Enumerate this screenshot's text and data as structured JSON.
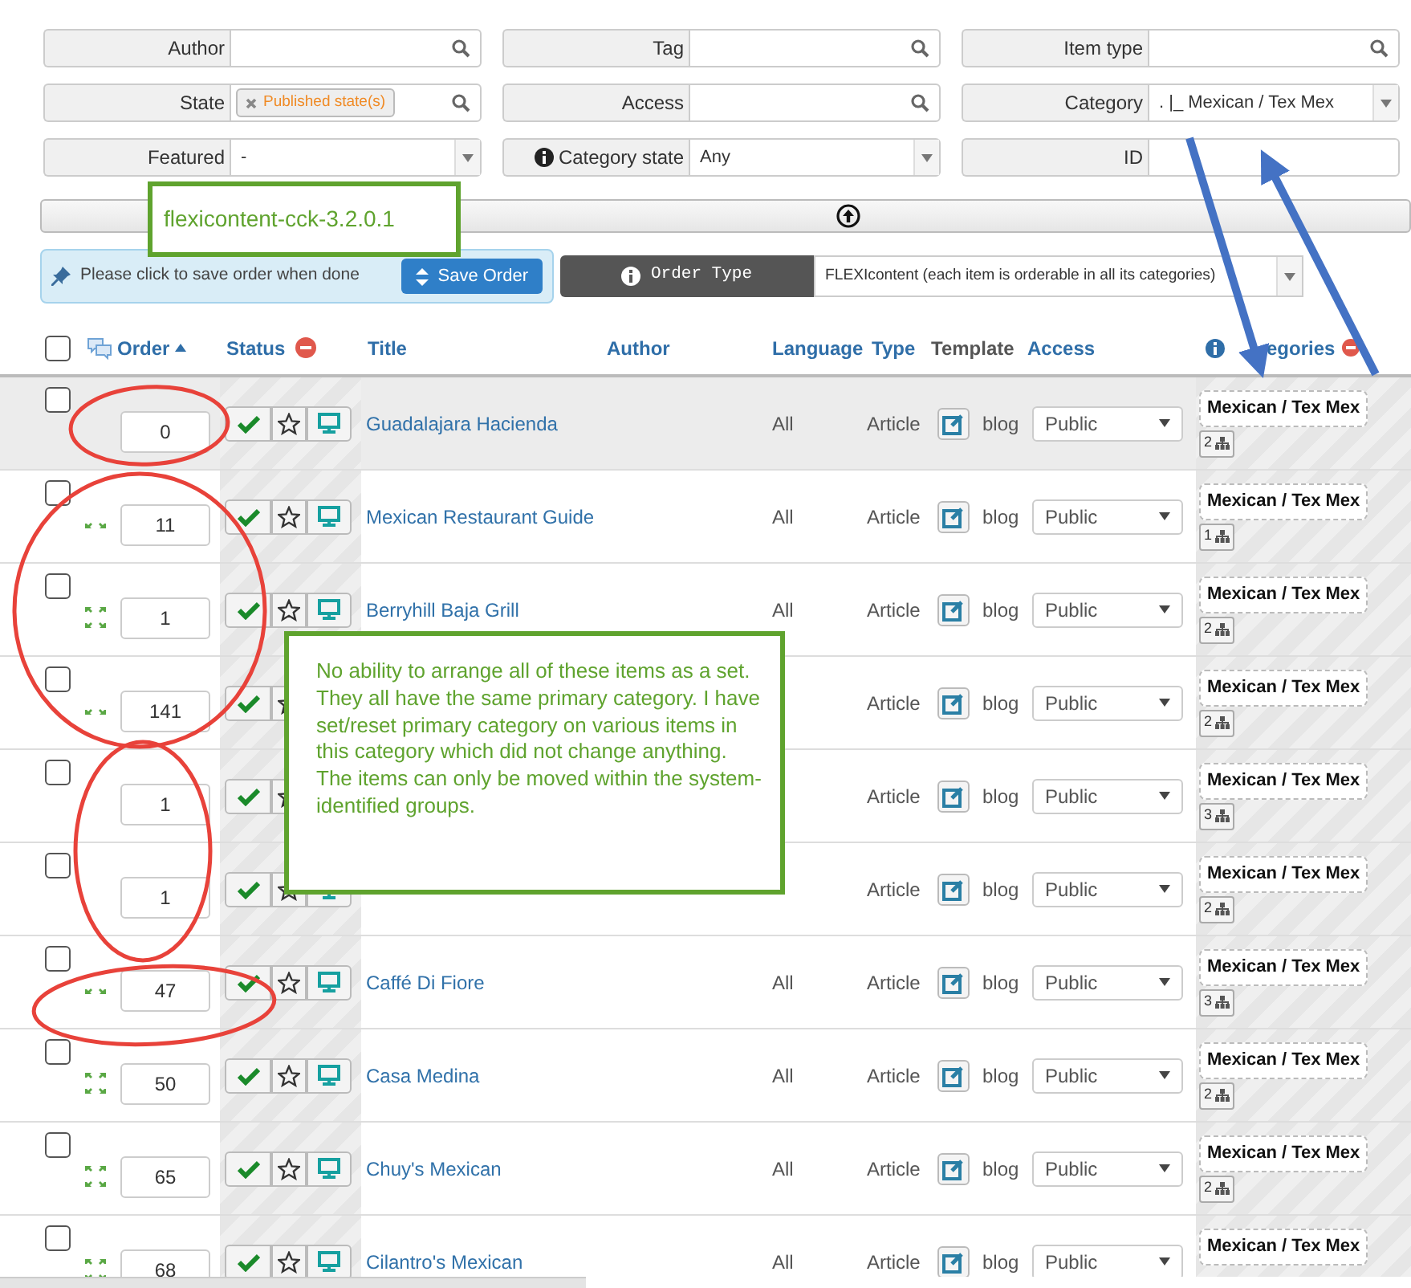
{
  "filters": [
    {
      "label": "Author",
      "kind": "search",
      "info": false
    },
    {
      "label": "Tag",
      "kind": "search",
      "info": false
    },
    {
      "label": "Item type",
      "kind": "search",
      "info": false
    },
    {
      "label": "State",
      "kind": "tags",
      "tags": [
        "Published state(s)"
      ],
      "info": false
    },
    {
      "label": "Access",
      "kind": "search",
      "info": false
    },
    {
      "label": "Category",
      "kind": "select",
      "value": ". |_ Mexican / Tex Mex",
      "info": false
    },
    {
      "label": "Featured",
      "kind": "select",
      "value": "-",
      "info": false
    },
    {
      "label": "Category state",
      "kind": "select",
      "value": "Any",
      "info": true
    },
    {
      "label": "ID",
      "kind": "text",
      "info": false
    }
  ],
  "order_notice": {
    "text": "Please click to save order when done",
    "button": "Save Order"
  },
  "order_type": {
    "label": "Order Type",
    "value": "FLEXIcontent (each item is orderable in all its categories)"
  },
  "select_all_checked": false,
  "columns": [
    "Order",
    "Status",
    "Title",
    "Author",
    "Language",
    "Type",
    "Template",
    "Access",
    "egories"
  ],
  "rows": [
    {
      "checked": false,
      "highlighted": true,
      "kind": "fixed",
      "order": "0",
      "title": "Guadalajara Hacienda",
      "language": "All",
      "type": "Article",
      "template": "blog",
      "access": "Public",
      "category": "Mexican / Tex Mex",
      "category_count": "2"
    },
    {
      "checked": false,
      "highlighted": false,
      "kind": "half",
      "order": "11",
      "title": "Mexican Restaurant Guide",
      "language": "All",
      "type": "Article",
      "template": "blog",
      "access": "Public",
      "category": "Mexican / Tex Mex",
      "category_count": "1"
    },
    {
      "checked": false,
      "highlighted": false,
      "kind": "movable",
      "order": "1",
      "title": "Berryhill Baja Grill",
      "language": "All",
      "type": "Article",
      "template": "blog",
      "access": "Public",
      "category": "Mexican / Tex Mex",
      "category_count": "2"
    },
    {
      "checked": false,
      "highlighted": false,
      "kind": "half",
      "order": "141",
      "type": "Article",
      "template": "blog",
      "access": "Public",
      "category": "Mexican / Tex Mex",
      "category_count": "2"
    },
    {
      "checked": false,
      "highlighted": false,
      "kind": "fixed",
      "order": "1",
      "type": "Article",
      "template": "blog",
      "access": "Public",
      "category": "Mexican / Tex Mex",
      "category_count": "3"
    },
    {
      "checked": false,
      "highlighted": false,
      "kind": "fixed",
      "order": "1",
      "type": "Article",
      "template": "blog",
      "access": "Public",
      "category": "Mexican / Tex Mex",
      "category_count": "2"
    },
    {
      "checked": false,
      "highlighted": false,
      "kind": "half",
      "order": "47",
      "title": "Caffé Di Fiore",
      "language": "All",
      "type": "Article",
      "template": "blog",
      "access": "Public",
      "category": "Mexican / Tex Mex",
      "category_count": "3"
    },
    {
      "checked": false,
      "highlighted": false,
      "kind": "movable",
      "order": "50",
      "title": "Casa Medina",
      "language": "All",
      "type": "Article",
      "template": "blog",
      "access": "Public",
      "category": "Mexican / Tex Mex",
      "category_count": "2"
    },
    {
      "checked": false,
      "highlighted": false,
      "kind": "movable",
      "order": "65",
      "title": "Chuy's Mexican",
      "language": "All",
      "type": "Article",
      "template": "blog",
      "access": "Public",
      "category": "Mexican / Tex Mex",
      "category_count": "2"
    },
    {
      "checked": false,
      "highlighted": false,
      "kind": "movable",
      "order": "68",
      "title": "Cilantro's Mexican",
      "language": "All",
      "type": "Article",
      "template": "blog",
      "access": "Public",
      "category": "Mexican / Tex Mex"
    }
  ],
  "callouts": [
    {
      "text": "flexicontent-cck-3.2.0.1"
    },
    {
      "text": "No ability to arrange all of these items as a set. They all have the same primary category. I have set/reset primary category on various items in this category which did not change anything. The items can only be moved within the system-identified groups."
    }
  ]
}
